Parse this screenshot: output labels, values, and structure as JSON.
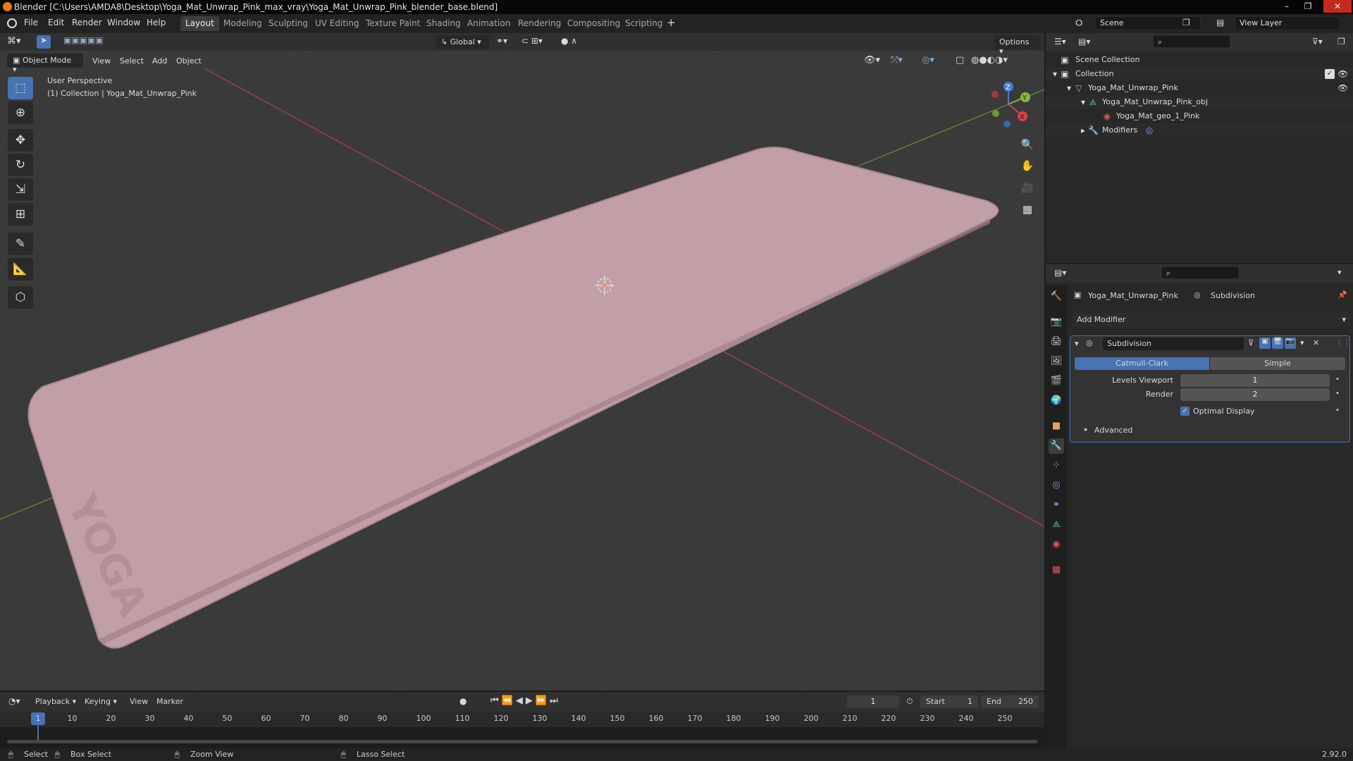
{
  "window": {
    "title": "Blender [C:\\Users\\AMDA8\\Desktop\\Yoga_Mat_Unwrap_Pink_max_vray\\Yoga_Mat_Unwrap_Pink_blender_base.blend]",
    "controls": [
      "–",
      "❐",
      "✕"
    ]
  },
  "menu": [
    "File",
    "Edit",
    "Render",
    "Window",
    "Help"
  ],
  "workspaces": [
    "Layout",
    "Modeling",
    "Sculpting",
    "UV Editing",
    "Texture Paint",
    "Shading",
    "Animation",
    "Rendering",
    "Compositing",
    "Scripting"
  ],
  "workspace_active": "Layout",
  "scene": {
    "label": "Scene",
    "view_layer": "View Layer"
  },
  "viewport": {
    "mode": "Object Mode",
    "menus": [
      "View",
      "Select",
      "Add",
      "Object"
    ],
    "transform_orientation": "Global",
    "options_label": "Options",
    "perspective": "User Perspective",
    "collection_info": "(1) Collection | Yoga_Mat_Unwrap_Pink",
    "mat_text": "YOGA",
    "gizmo": {
      "x": "X",
      "y": "Y",
      "z": "Z"
    }
  },
  "tools": [
    "select-box",
    "cursor",
    "move",
    "rotate",
    "scale",
    "transform",
    "annotate",
    "measure",
    "add-cube"
  ],
  "outliner": {
    "root": "Scene Collection",
    "items": [
      {
        "label": "Collection",
        "depth": 1
      },
      {
        "label": "Yoga_Mat_Unwrap_Pink",
        "depth": 2
      },
      {
        "label": "Yoga_Mat_Unwrap_Pink_obj",
        "depth": 3
      },
      {
        "label": "Yoga_Mat_geo_1_Pink",
        "depth": 4
      },
      {
        "label": "Modifiers",
        "depth": 3
      }
    ]
  },
  "properties": {
    "object_name": "Yoga_Mat_Unwrap_Pink",
    "modifier_context": "Subdivision",
    "add_modifier": "Add Modifier",
    "modifier": {
      "name": "Subdivision",
      "types": [
        "Catmull-Clark",
        "Simple"
      ],
      "active_type": "Catmull-Clark",
      "levels_viewport_label": "Levels Viewport",
      "levels_viewport": "1",
      "render_label": "Render",
      "render": "2",
      "optimal_display_label": "Optimal Display",
      "optimal_display": true,
      "advanced_label": "Advanced"
    }
  },
  "timeline": {
    "menus": [
      "Playback",
      "Keying",
      "View",
      "Marker"
    ],
    "current_frame": "1",
    "start_label": "Start",
    "start": "1",
    "end_label": "End",
    "end": "250",
    "ticks": [
      "1",
      "10",
      "20",
      "30",
      "40",
      "50",
      "60",
      "70",
      "80",
      "90",
      "100",
      "110",
      "120",
      "130",
      "140",
      "150",
      "160",
      "170",
      "180",
      "190",
      "200",
      "210",
      "220",
      "230",
      "240",
      "250"
    ]
  },
  "status": {
    "select": "Select",
    "box_select": "Box Select",
    "zoom_view": "Zoom View",
    "lasso_select": "Lasso Select",
    "version": "2.92.0"
  },
  "colors": {
    "accent": "#4772b3",
    "mat": "#c0a0a6",
    "grid": "#3a3a3a",
    "x_axis": "#b3424a",
    "y_axis": "#6a8f2c"
  }
}
